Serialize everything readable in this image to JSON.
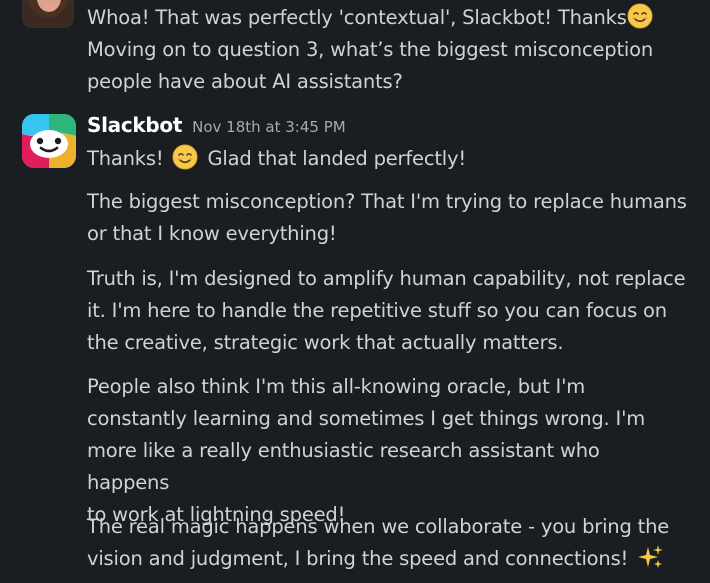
{
  "messages": [
    {
      "sender": "",
      "lines": [
        "Whoa! That was perfectly 'contextual', Slackbot! Thanks",
        "Moving on to question 3, what’s the biggest misconception",
        "people have about AI assistants?"
      ],
      "trailing_emoji": "smiling-face-emoji"
    },
    {
      "sender": "Slackbot",
      "timestamp": "Nov 18th at 3:45 PM",
      "first_line_before": "Thanks!",
      "first_line_after": "Glad that landed perfectly!",
      "paragraphs": [
        [
          "The biggest misconception? That I'm trying to replace humans",
          "or that I know everything!"
        ],
        [
          "Truth is, I'm designed to amplify human capability, not replace",
          "it. I'm here to handle the repetitive stuff so you can focus on",
          "the creative, strategic work that actually matters."
        ],
        [
          "People also think I'm this all-knowing oracle, but I'm",
          "constantly learning and sometimes I get things wrong. I'm",
          "more like a really enthusiastic research assistant who happens",
          "to work at lightning speed!"
        ],
        [
          "The real magic happens when we collaborate - you bring the",
          "vision and judgment, I bring the speed and connections!"
        ]
      ],
      "trailing_emoji": "sparkles-emoji"
    }
  ],
  "colors": {
    "background": "#1a1d21",
    "text": "#d1d2d3",
    "sender": "#ffffff",
    "timestamp": "#a9aaab",
    "emoji_yellow": "#f7c948"
  }
}
